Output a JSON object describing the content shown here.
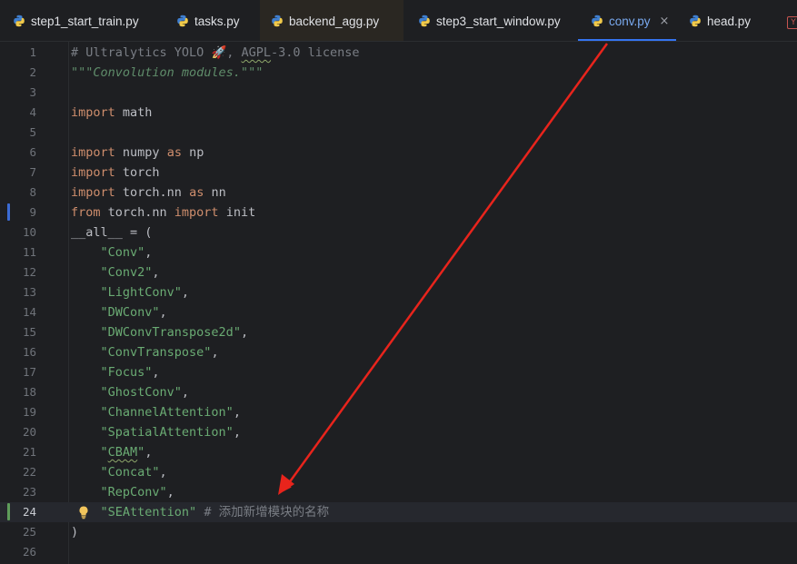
{
  "tabs": [
    {
      "label": "step1_start_train.py",
      "state": "normal"
    },
    {
      "label": "tasks.py",
      "state": "normal"
    },
    {
      "label": "backend_agg.py",
      "state": "hovered"
    },
    {
      "label": "step3_start_window.py",
      "state": "normal"
    },
    {
      "label": "conv.py",
      "state": "active",
      "close": "×"
    },
    {
      "label": "head.py",
      "state": "normal"
    }
  ],
  "overflow_badge": "Y",
  "editor": {
    "lines": [
      {
        "n": "1",
        "tokens": [
          {
            "t": "# Ultralytics YOLO ",
            "c": "cmt"
          },
          {
            "t": "🚀",
            "c": "rocket"
          },
          {
            "t": ", ",
            "c": "cmt"
          },
          {
            "t": "AGPL",
            "c": "cmt squig"
          },
          {
            "t": "-3.0 license",
            "c": "cmt"
          }
        ]
      },
      {
        "n": "2",
        "tokens": [
          {
            "t": "\"\"\"Convolution modules.\"\"\"",
            "c": "doc"
          }
        ]
      },
      {
        "n": "3",
        "tokens": []
      },
      {
        "n": "4",
        "tokens": [
          {
            "t": "import",
            "c": "kw"
          },
          {
            "t": " math",
            "c": "plain"
          }
        ]
      },
      {
        "n": "5",
        "tokens": []
      },
      {
        "n": "6",
        "tokens": [
          {
            "t": "import",
            "c": "kw"
          },
          {
            "t": " numpy ",
            "c": "plain"
          },
          {
            "t": "as",
            "c": "kw"
          },
          {
            "t": " np",
            "c": "plain"
          }
        ]
      },
      {
        "n": "7",
        "tokens": [
          {
            "t": "import",
            "c": "kw"
          },
          {
            "t": " torch",
            "c": "plain"
          }
        ]
      },
      {
        "n": "8",
        "tokens": [
          {
            "t": "import",
            "c": "kw"
          },
          {
            "t": " torch.nn ",
            "c": "plain"
          },
          {
            "t": "as",
            "c": "kw"
          },
          {
            "t": " nn",
            "c": "plain"
          }
        ]
      },
      {
        "n": "9",
        "gutter": "#3b6bd4",
        "tokens": [
          {
            "t": "from",
            "c": "kw"
          },
          {
            "t": " torch.nn ",
            "c": "plain"
          },
          {
            "t": "import",
            "c": "kw"
          },
          {
            "t": " init",
            "c": "plain"
          }
        ]
      },
      {
        "n": "10",
        "tokens": [
          {
            "t": "__all__ = (",
            "c": "plain"
          }
        ]
      },
      {
        "n": "11",
        "tokens": [
          {
            "t": "    ",
            "c": "plain"
          },
          {
            "t": "\"Conv\"",
            "c": "str"
          },
          {
            "t": ",",
            "c": "plain"
          }
        ]
      },
      {
        "n": "12",
        "tokens": [
          {
            "t": "    ",
            "c": "plain"
          },
          {
            "t": "\"Conv2\"",
            "c": "str"
          },
          {
            "t": ",",
            "c": "plain"
          }
        ]
      },
      {
        "n": "13",
        "tokens": [
          {
            "t": "    ",
            "c": "plain"
          },
          {
            "t": "\"LightConv\"",
            "c": "str"
          },
          {
            "t": ",",
            "c": "plain"
          }
        ]
      },
      {
        "n": "14",
        "tokens": [
          {
            "t": "    ",
            "c": "plain"
          },
          {
            "t": "\"DWConv\"",
            "c": "str"
          },
          {
            "t": ",",
            "c": "plain"
          }
        ]
      },
      {
        "n": "15",
        "tokens": [
          {
            "t": "    ",
            "c": "plain"
          },
          {
            "t": "\"DWConvTranspose2d\"",
            "c": "str"
          },
          {
            "t": ",",
            "c": "plain"
          }
        ]
      },
      {
        "n": "16",
        "tokens": [
          {
            "t": "    ",
            "c": "plain"
          },
          {
            "t": "\"ConvTranspose\"",
            "c": "str"
          },
          {
            "t": ",",
            "c": "plain"
          }
        ]
      },
      {
        "n": "17",
        "tokens": [
          {
            "t": "    ",
            "c": "plain"
          },
          {
            "t": "\"Focus\"",
            "c": "str"
          },
          {
            "t": ",",
            "c": "plain"
          }
        ]
      },
      {
        "n": "18",
        "tokens": [
          {
            "t": "    ",
            "c": "plain"
          },
          {
            "t": "\"GhostConv\"",
            "c": "str"
          },
          {
            "t": ",",
            "c": "plain"
          }
        ]
      },
      {
        "n": "19",
        "tokens": [
          {
            "t": "    ",
            "c": "plain"
          },
          {
            "t": "\"ChannelAttention\"",
            "c": "str"
          },
          {
            "t": ",",
            "c": "plain"
          }
        ]
      },
      {
        "n": "20",
        "tokens": [
          {
            "t": "    ",
            "c": "plain"
          },
          {
            "t": "\"SpatialAttention\"",
            "c": "str"
          },
          {
            "t": ",",
            "c": "plain"
          }
        ]
      },
      {
        "n": "21",
        "tokens": [
          {
            "t": "    ",
            "c": "plain"
          },
          {
            "t": "\"",
            "c": "str"
          },
          {
            "t": "CBAM",
            "c": "str squig"
          },
          {
            "t": "\"",
            "c": "str"
          },
          {
            "t": ",",
            "c": "plain"
          }
        ]
      },
      {
        "n": "22",
        "tokens": [
          {
            "t": "    ",
            "c": "plain"
          },
          {
            "t": "\"Concat\"",
            "c": "str"
          },
          {
            "t": ",",
            "c": "plain"
          }
        ]
      },
      {
        "n": "23",
        "tokens": [
          {
            "t": "    ",
            "c": "plain"
          },
          {
            "t": "\"RepConv\"",
            "c": "str"
          },
          {
            "t": ",",
            "c": "plain"
          }
        ]
      },
      {
        "n": "24",
        "current": true,
        "bulb": true,
        "gutter": "#5e9c5a",
        "tokens": [
          {
            "t": "    ",
            "c": "plain"
          },
          {
            "t": "\"SEAttention\"",
            "c": "str"
          },
          {
            "t": " # 添加新增模块的名称",
            "c": "cmt"
          }
        ]
      },
      {
        "n": "25",
        "tokens": [
          {
            "t": ")",
            "c": "plain"
          }
        ]
      },
      {
        "n": "26",
        "tokens": []
      }
    ]
  },
  "colors": {
    "background": "#1e1f22",
    "accent": "#3574f0",
    "arrow": "#e8241c"
  }
}
